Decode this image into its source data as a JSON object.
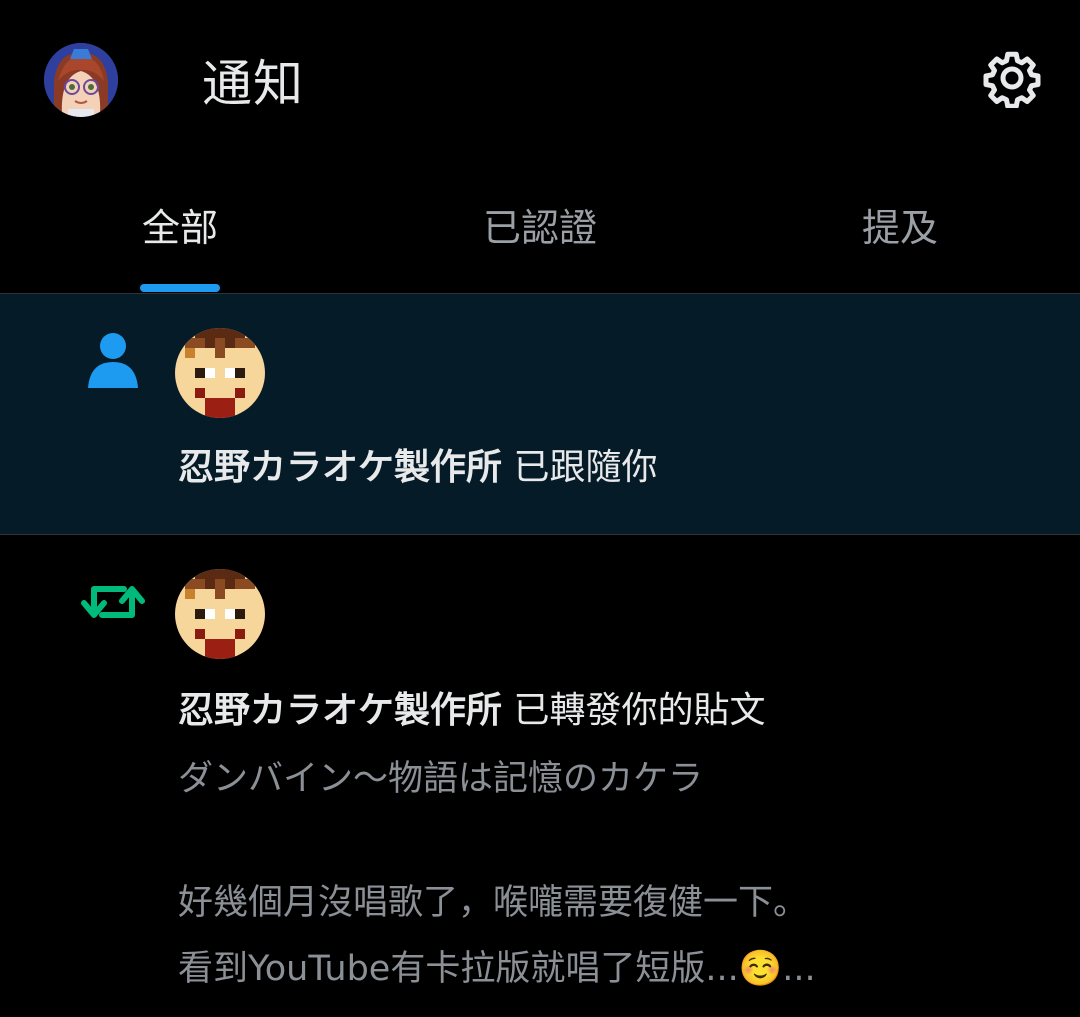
{
  "header": {
    "title": "通知",
    "avatar_icon": "user-avatar-anime",
    "settings_icon": "gear-icon"
  },
  "tabs": [
    {
      "label": "全部",
      "active": true
    },
    {
      "label": "已認證",
      "active": false
    },
    {
      "label": "提及",
      "active": false
    }
  ],
  "notifications": [
    {
      "type": "follow",
      "type_icon": "person-icon",
      "type_color": "#1d9bf0",
      "user_name": "忍野カラオケ製作所",
      "action": " 已跟隨你"
    },
    {
      "type": "repost",
      "type_icon": "repost-icon",
      "type_color": "#00ba7c",
      "user_name": "忍野カラオケ製作所",
      "action": " 已轉發你的貼文",
      "post_lines": [
        "ダンバイン～物語は記憶のカケラ",
        "",
        "好幾個月沒唱歌了，喉嚨需要復健一下。",
        "看到YouTube有卡拉版就唱了短版..."
      ],
      "post_emoji": "☺️",
      "post_trailing": "..."
    }
  ],
  "colors": {
    "accent": "#1d9bf0",
    "highlight_bg": "#061b28",
    "repost_green": "#00ba7c"
  }
}
